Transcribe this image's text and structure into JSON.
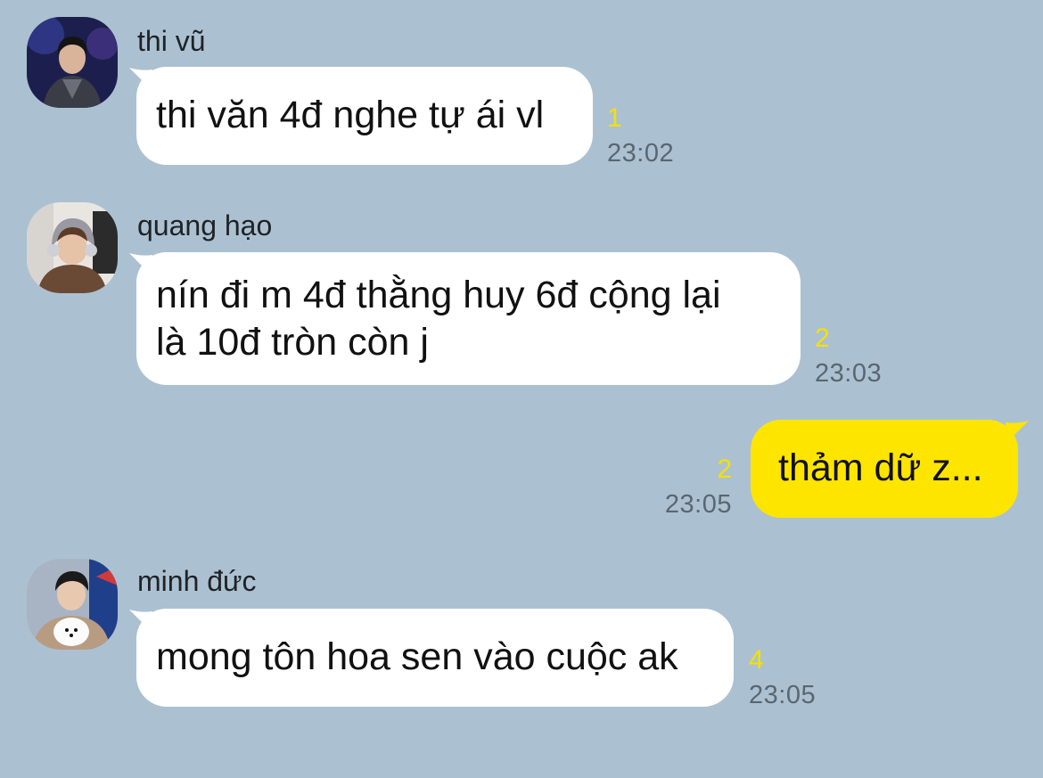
{
  "chat": {
    "background": "#abc1d1",
    "my_bubble_color": "#fee500",
    "other_bubble_color": "#ffffff",
    "unread_color": "#f5e000",
    "messages": [
      {
        "sender": "thi vũ",
        "avatar": "profile-photo",
        "text": "thi văn 4đ nghe tự ái vl",
        "unread": "1",
        "time": "23:02"
      },
      {
        "sender": "quang hạo",
        "avatar": "profile-photo",
        "lines": [
          "nín đi m 4đ thằng huy 6đ cộng lại",
          "là 10đ tròn còn j"
        ],
        "unread": "2",
        "time": "23:03"
      },
      {
        "sender": "me",
        "text": "thảm dữ z...",
        "unread": "2",
        "time": "23:05"
      },
      {
        "sender": "minh đức",
        "avatar": "profile-photo",
        "text": "mong tôn hoa sen vào cuộc ak",
        "unread": "4",
        "time": "23:05"
      }
    ]
  }
}
